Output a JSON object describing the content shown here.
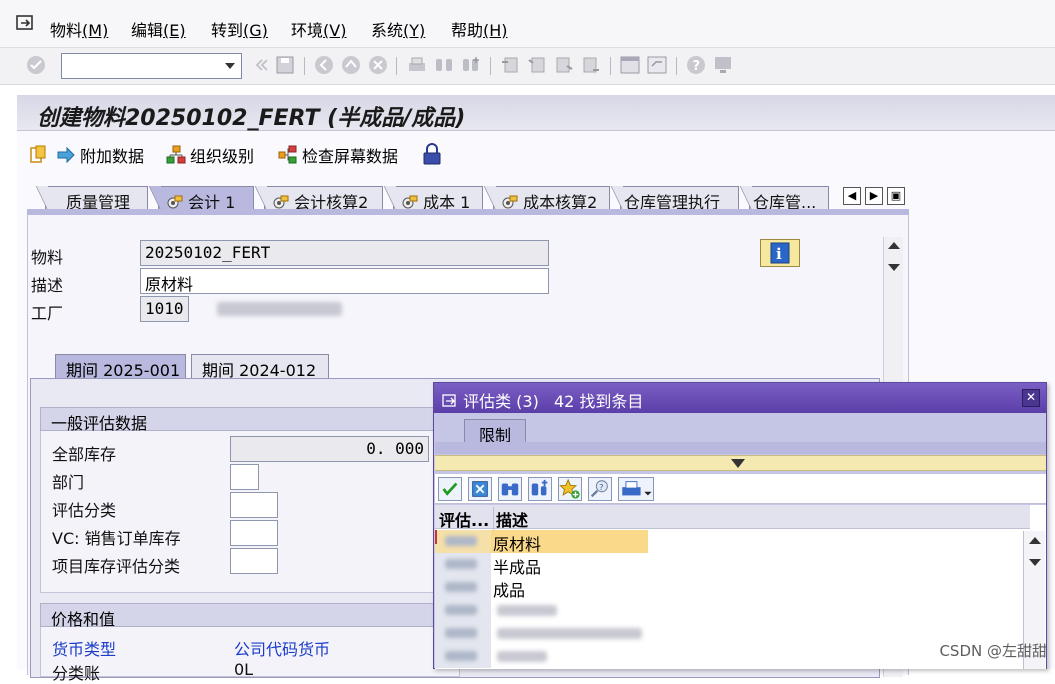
{
  "menu": {
    "items": [
      {
        "label": "物料",
        "key": "(M)"
      },
      {
        "label": "编辑",
        "key": "(E)"
      },
      {
        "label": "转到",
        "key": "(G)"
      },
      {
        "label": "环境",
        "key": "(V)"
      },
      {
        "label": "系统",
        "key": "(Y)"
      },
      {
        "label": "帮助",
        "key": "(H)"
      }
    ]
  },
  "title": "创建物料20250102_FERT (半成品/成品)",
  "app_toolbar": {
    "additional_data": "附加数据",
    "org_levels": "组织级别",
    "check_screen_data": "检查屏幕数据"
  },
  "tabs": [
    {
      "label": "质量管理",
      "active": false
    },
    {
      "label": "会计 1",
      "active": true
    },
    {
      "label": "会计核算2",
      "active": false
    },
    {
      "label": "成本 1",
      "active": false
    },
    {
      "label": "成本核算2",
      "active": false
    },
    {
      "label": "仓库管理执行",
      "active": false
    },
    {
      "label": "仓库管...",
      "active": false
    }
  ],
  "header": {
    "material_label": "物料",
    "material_value": "20250102_FERT",
    "description_label": "描述",
    "description_value": "原材料",
    "plant_label": "工厂",
    "plant_value": "1010"
  },
  "period_tabs": [
    {
      "label": "期间 2025-001",
      "active": true
    },
    {
      "label": "期间 2024-012",
      "active": false
    }
  ],
  "general_valuation": {
    "heading": "一般评估数据",
    "total_stock_label": "全部库存",
    "total_stock_value": "0. 000",
    "division_label": "部门",
    "valuation_class_label": "评估分类",
    "vc_sales_order_label": "VC: 销售订单库存",
    "project_stock_label": "项目库存评估分类"
  },
  "price_values": {
    "heading": "价格和值",
    "currency_type": "货币类型",
    "company_code_currency": "公司代码货币",
    "row3_label": "分类账",
    "row3_value": "0L"
  },
  "popup": {
    "title": "评估类 (3)",
    "count_text": "42 找到条目",
    "restrict_tab": "限制",
    "col_key": "评估...",
    "col_desc": "描述",
    "rows": [
      "原材料",
      "半成品",
      "成品"
    ]
  },
  "watermark": "CSDN @左甜甜"
}
